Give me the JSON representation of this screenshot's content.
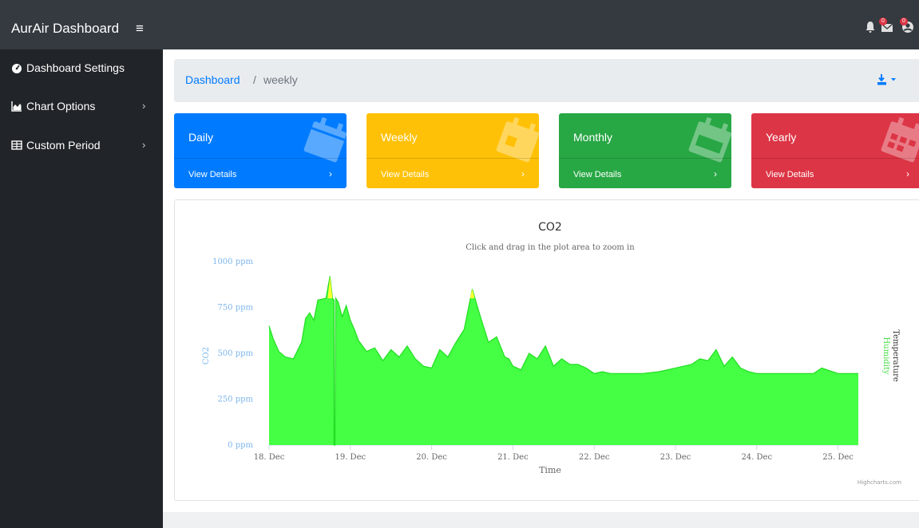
{
  "navbar": {
    "brand": "AurAir Dashboard",
    "hamburger": "≡",
    "icons": [
      {
        "name": "bell-icon",
        "badge": ""
      },
      {
        "name": "envelope-icon",
        "badge": "0"
      },
      {
        "name": "user-icon",
        "badge": "0"
      }
    ]
  },
  "sidebar": {
    "items": [
      {
        "label": "Dashboard Settings",
        "icon": "tachometer-icon",
        "chevron": ""
      },
      {
        "label": "Chart Options",
        "icon": "area-chart-icon",
        "chevron": "›"
      },
      {
        "label": "Custom Period",
        "icon": "table-icon",
        "chevron": "›"
      }
    ]
  },
  "breadcrumb": {
    "link": "Dashboard",
    "separator": "/",
    "current": "weekly"
  },
  "cards": [
    {
      "title": "Daily",
      "details": "View Details",
      "arrow": "›",
      "color": "#007bff",
      "icon": "calendar-day-icon"
    },
    {
      "title": "Weekly",
      "details": "View Details",
      "arrow": "›",
      "color": "#ffc107",
      "icon": "calendar-week-icon"
    },
    {
      "title": "Monthly",
      "details": "View Details",
      "arrow": "›",
      "color": "#28a745",
      "icon": "calendar-month-icon"
    },
    {
      "title": "Yearly",
      "details": "View Details",
      "arrow": "›",
      "color": "#dc3545",
      "icon": "calendar-year-icon"
    }
  ],
  "chart_data": {
    "type": "area",
    "title": "CO2",
    "subtitle": "Click and drag in the plot area to zoom in",
    "xlabel": "Time",
    "ylabel": "CO2",
    "right_axis_labels": [
      "Temperature",
      "Humidity"
    ],
    "credit": "Highcharts.com",
    "ylim": [
      0,
      1000
    ],
    "y_ticks": [
      "0 ppm",
      "250 ppm",
      "500 ppm",
      "750 ppm",
      "1000 ppm"
    ],
    "y_tick_values": [
      0,
      250,
      500,
      750,
      1000
    ],
    "x_ticks": [
      "18. Dec",
      "19. Dec",
      "20. Dec",
      "21. Dec",
      "22. Dec",
      "23. Dec",
      "24. Dec",
      "25. Dec"
    ],
    "xlim": [
      0,
      7.25
    ],
    "fill_color": "#44ff44",
    "line_color": "#22dd22",
    "threshold_color": "#ffff33",
    "series": [
      {
        "x": [
          0,
          0.05,
          0.12,
          0.2,
          0.3,
          0.4,
          0.45,
          0.5,
          0.55,
          0.6,
          0.7,
          0.75,
          0.78,
          0.8,
          0.8,
          0.81,
          0.82,
          0.85,
          0.9,
          0.95,
          1.0,
          1.05,
          1.1,
          1.2,
          1.3,
          1.4,
          1.5,
          1.6,
          1.7,
          1.8,
          1.9,
          2.0,
          2.1,
          2.2,
          2.3,
          2.4,
          2.5,
          2.6,
          2.7,
          2.8,
          2.9,
          2.95,
          3.0,
          3.1,
          3.2,
          3.3,
          3.4,
          3.5,
          3.6,
          3.7,
          3.8,
          3.9,
          4.0,
          4.1,
          4.2,
          4.3,
          4.4,
          4.5,
          4.6,
          4.8,
          5.0,
          5.2,
          5.3,
          5.4,
          5.5,
          5.6,
          5.7,
          5.8,
          5.9,
          6.0,
          6.2,
          6.4,
          6.6,
          6.7,
          6.8,
          7.0,
          7.25
        ],
        "values": [
          650,
          580,
          510,
          480,
          470,
          560,
          690,
          720,
          680,
          790,
          800,
          920,
          800,
          790,
          0,
          0,
          800,
          780,
          700,
          760,
          680,
          630,
          570,
          510,
          530,
          460,
          520,
          480,
          540,
          470,
          430,
          420,
          520,
          480,
          560,
          630,
          850,
          700,
          560,
          590,
          480,
          470,
          430,
          410,
          500,
          470,
          540,
          430,
          470,
          440,
          440,
          420,
          390,
          400,
          390,
          390,
          390,
          390,
          390,
          400,
          420,
          440,
          470,
          460,
          520,
          430,
          480,
          420,
          400,
          390,
          390,
          390,
          390,
          390,
          420,
          390,
          390
        ]
      }
    ]
  }
}
